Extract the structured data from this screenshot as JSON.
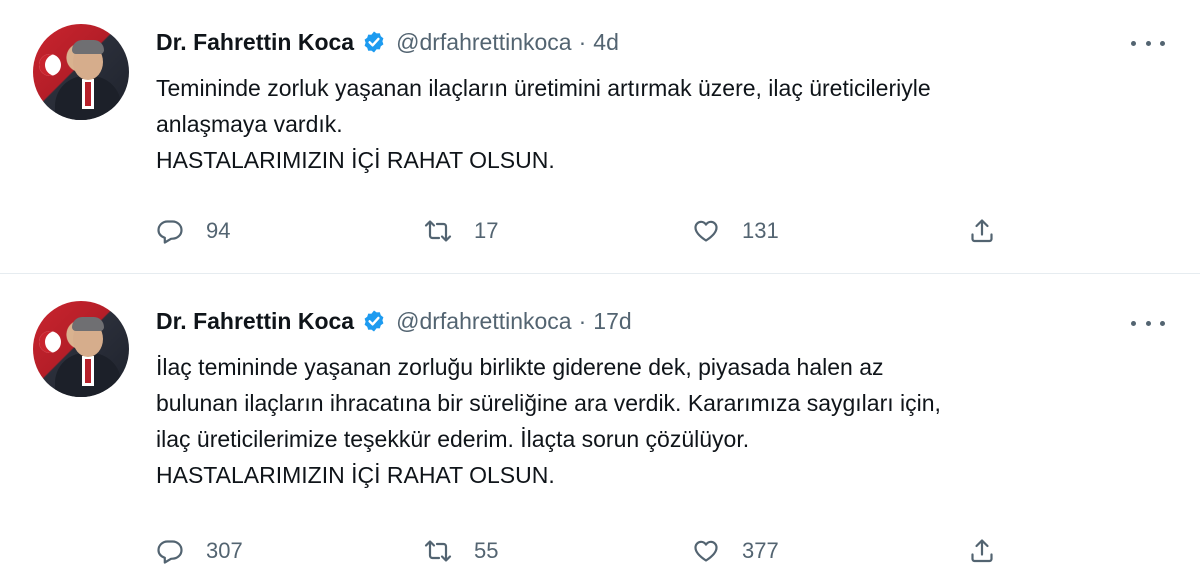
{
  "tweets": [
    {
      "author": "Dr. Fahrettin Koca",
      "handle": "@drfahrettinkoca",
      "separator": "·",
      "time": "4d",
      "lines": [
        "Temininde zorluk yaşanan ilaçların üretimini artırmak üzere, ilaç üreticileriyle",
        "anlaşmaya vardık.",
        "HASTALARIMIZIN İÇİ RAHAT OLSUN."
      ],
      "replies": "94",
      "retweets": "17",
      "likes": "131"
    },
    {
      "author": "Dr. Fahrettin Koca",
      "handle": "@drfahrettinkoca",
      "separator": "·",
      "time": "17d",
      "lines": [
        "İlaç temininde yaşanan zorluğu birlikte giderene dek, piyasada halen az",
        "bulunan ilaçların ihracatına bir süreliğine ara verdik. Kararımıza saygıları için,",
        "ilaç üreticilerimize teşekkür ederim. İlaçta sorun çözülüyor.",
        "HASTALARIMIZIN İÇİ RAHAT OLSUN."
      ],
      "replies": "307",
      "retweets": "55",
      "likes": "377"
    }
  ],
  "icons": {
    "verified": "verified-badge-icon",
    "more": "more-options-icon",
    "reply": "reply-icon",
    "retweet": "retweet-icon",
    "like": "like-heart-icon",
    "share": "share-icon"
  },
  "colors": {
    "text": "#0f1419",
    "secondary": "#536471",
    "verified": "#1d9bf0",
    "divider": "#e6ecf0"
  }
}
